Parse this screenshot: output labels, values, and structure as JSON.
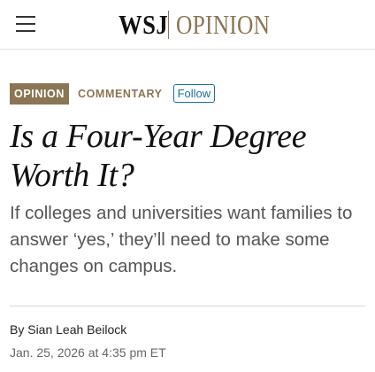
{
  "header": {
    "menu_icon": "hamburger-menu-icon",
    "logo_wsj": "WSJ",
    "logo_section": "OPINION",
    "brand_color": "#8a7554"
  },
  "article": {
    "section_tag": "OPINION",
    "category": "COMMENTARY",
    "follow_label": "Follow",
    "follow_color": "#1b6fa0",
    "headline": "Is a Four-Year Degree Worth It?",
    "dek": "If colleges and universities want families to answer ‘yes,’ they’ll need to make some changes on campus.",
    "byline_prefix": "By",
    "author": "Sian Leah Beilock",
    "timestamp": "Jan. 25, 2026 at 4:35 pm ET"
  }
}
